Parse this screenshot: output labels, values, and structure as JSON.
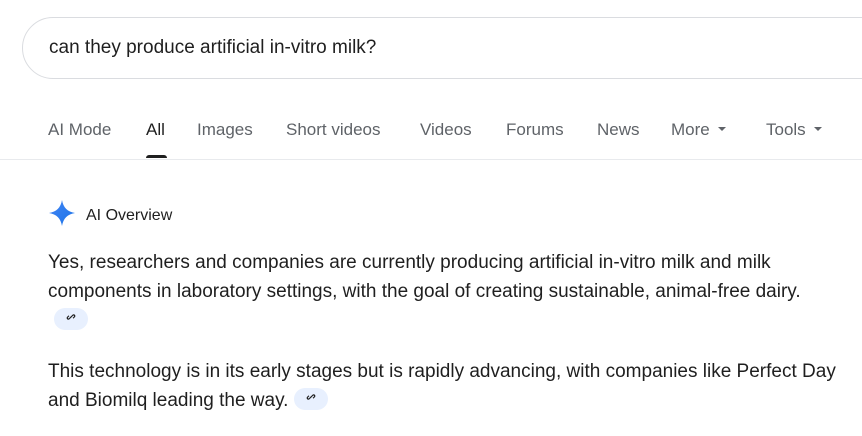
{
  "search": {
    "query": "can they produce artificial in-vitro milk?"
  },
  "tabs": [
    {
      "label": "AI Mode"
    },
    {
      "label": "All"
    },
    {
      "label": "Images"
    },
    {
      "label": "Short videos"
    },
    {
      "label": "Videos"
    },
    {
      "label": "Forums"
    },
    {
      "label": "News"
    },
    {
      "label": "More"
    },
    {
      "label": "Tools"
    }
  ],
  "active_tab": "All",
  "ai_overview": {
    "title": "AI Overview",
    "icon": "gemini-sparkle-icon",
    "paragraphs": [
      {
        "text": "Yes, researchers and companies are currently producing artificial in-vitro milk and milk components in laboratory settings, with the goal of creating sustainable, animal-free dairy."
      },
      {
        "text": "This technology is in its early stages but is rapidly advancing, with companies like Perfect Day and Biomilq leading the way."
      }
    ],
    "link_icon": "link-icon"
  },
  "colors": {
    "accent_blue": "#4285f4",
    "chip_bg": "#e8f0fe",
    "text_primary": "#1f1f1f",
    "text_secondary": "#5f6368"
  }
}
